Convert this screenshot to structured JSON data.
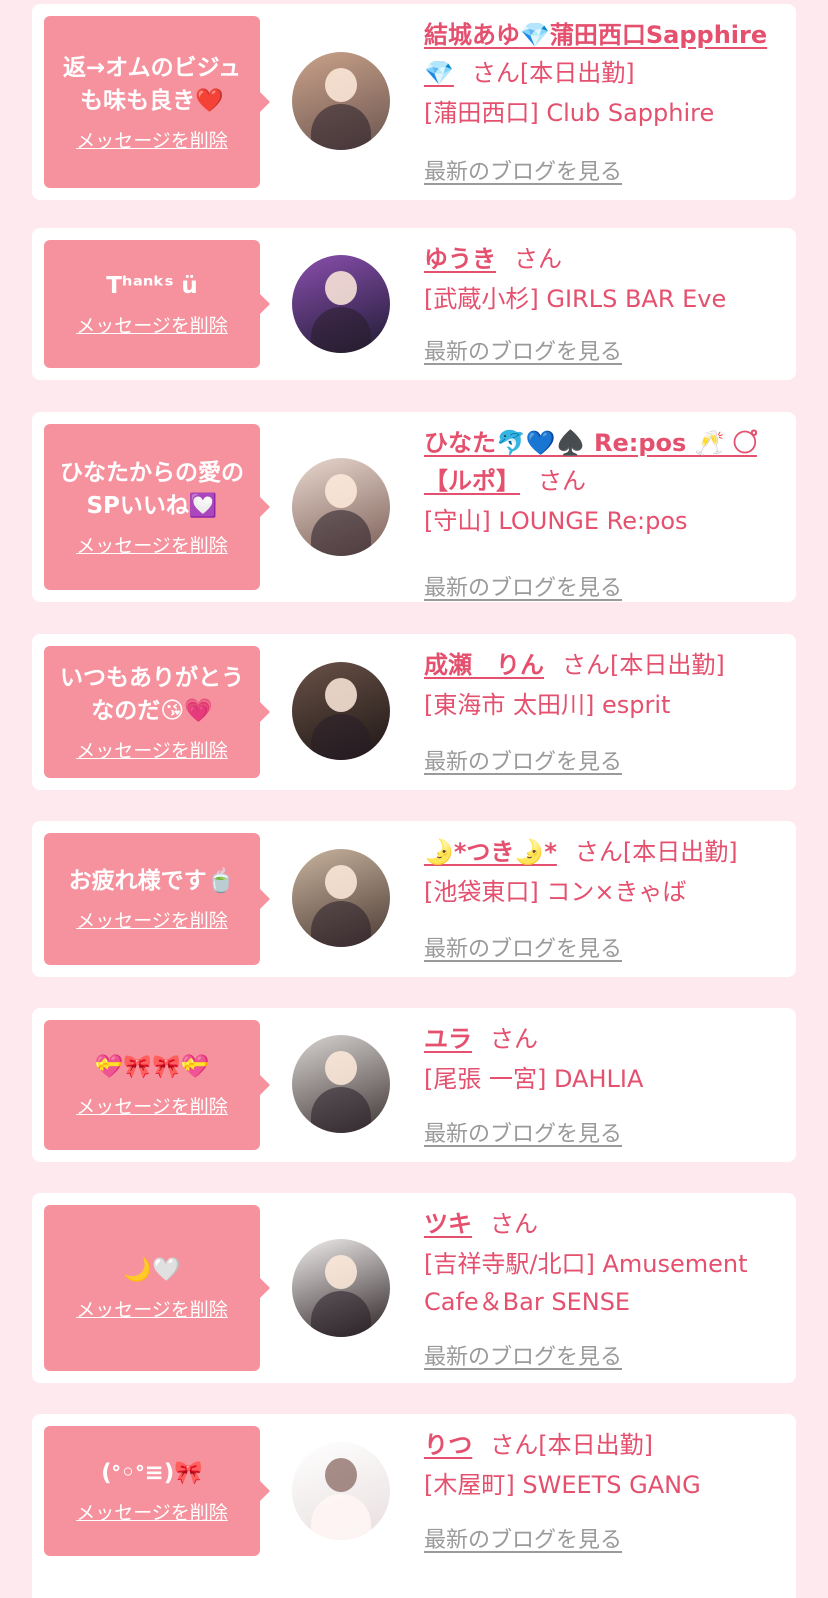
{
  "colors": {
    "page_bg": "#fde9ee",
    "bubble": "#f6929e",
    "accent": "#e4506e",
    "muted": "#9a9a9a"
  },
  "delete_label": "メッセージを削除",
  "blog_label": "最新のブログを見る",
  "san_label": "さん",
  "working_label": "[本日出勤]",
  "cards": [
    {
      "message": "返→オムのビジュも味も良き❤️",
      "name": "結城あゆ💎蒲田西口Sapphire💎",
      "working": true,
      "shop": "[蒲田西口] Club Sapphire"
    },
    {
      "message": "Tʰᵃⁿᵏˢ ü",
      "name": "ゆうき",
      "working": false,
      "shop": "[武蔵小杉] GIRLS BAR Eve"
    },
    {
      "message": "ひなたからの愛のSPいいね💟",
      "name": "ひなた🐬💙♠️ Re:pos 🥂 ○゚【ルポ】",
      "working": false,
      "shop": "[守山] LOUNGE Re:pos"
    },
    {
      "message": "いつもありがとうなのだ😘💗",
      "name": "成瀬　りん",
      "working": true,
      "shop": "[東海市 太田川] esprit"
    },
    {
      "message": "お疲れ様です🍵",
      "name": "🌛*つき🌛*",
      "working": true,
      "shop": "[池袋東口] コン×きゃば"
    },
    {
      "message": "💝🎀🎀💝",
      "name": "ユラ",
      "working": false,
      "shop": "[尾張 一宮] DAHLIA"
    },
    {
      "message": "🌙🤍",
      "name": "ツキ",
      "working": false,
      "shop": "[吉祥寺駅/北口] Amusement Cafe＆Bar SENSE"
    },
    {
      "message": "(ᐤ◦ᐤ≡)🎀",
      "name": "りつ",
      "working": true,
      "shop": "[木屋町] SWEETS GANG"
    }
  ]
}
